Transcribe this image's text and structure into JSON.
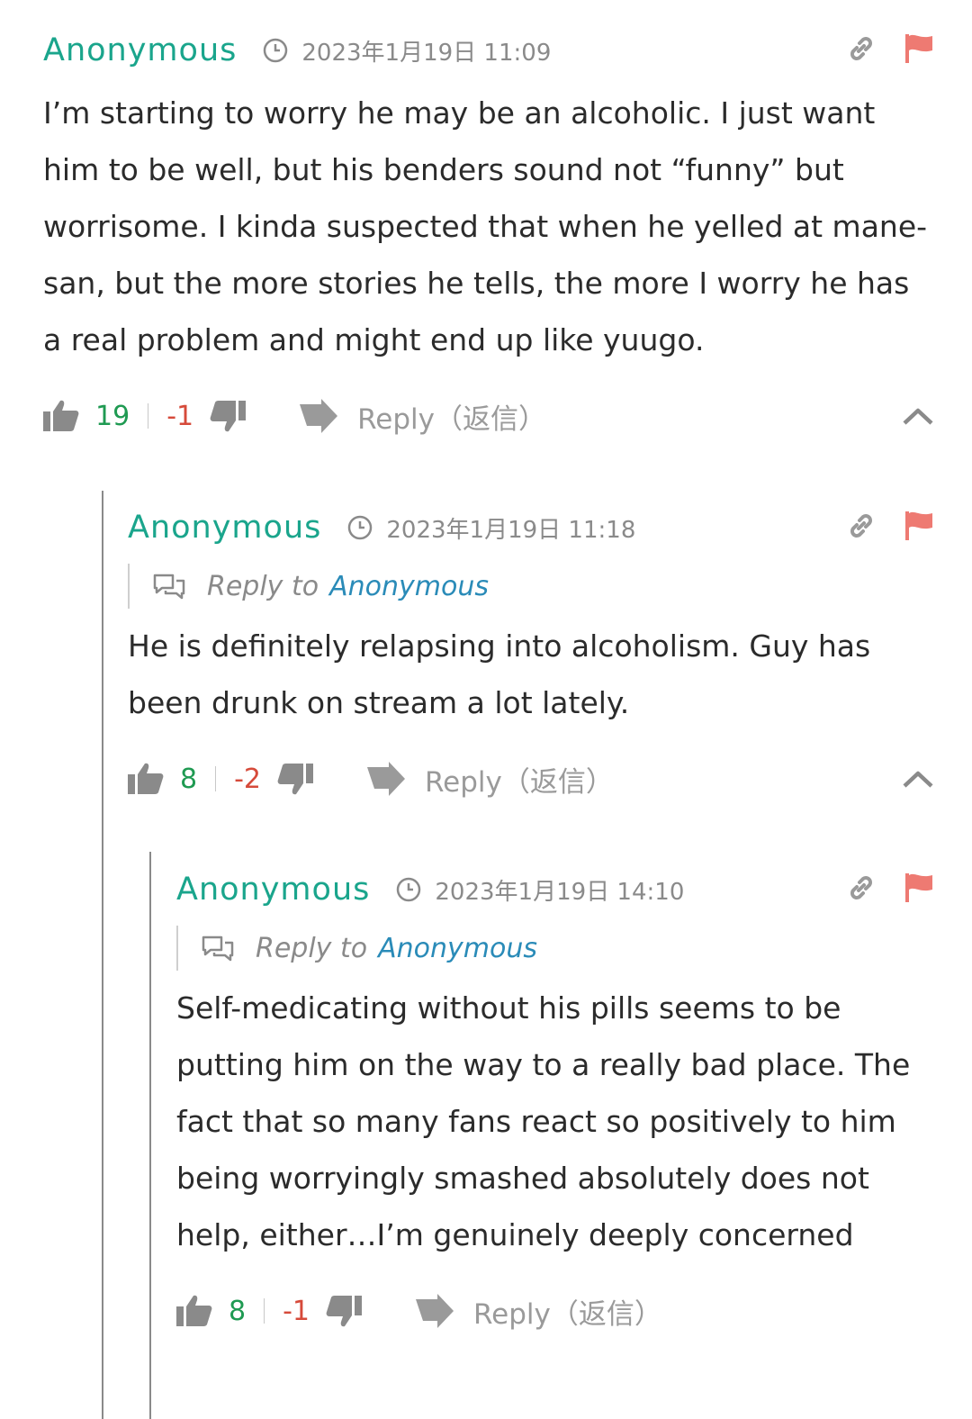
{
  "comments": [
    {
      "author": "Anonymous",
      "timestamp": "2023年1月19日 11:09",
      "body": "I’m starting to worry he may be an alcoholic. I just want him to be well, but his benders sound not “funny” but worrisome. I kinda suspected that when he yelled at mane-san, but the more stories he tells, the more I worry he has a real problem and might end up like yuugo.",
      "upvotes": "19",
      "downvotes": "-1",
      "reply_label": "Reply（返信）"
    },
    {
      "author": "Anonymous",
      "timestamp": "2023年1月19日 11:18",
      "reply_to_label": "Reply to",
      "reply_to_name": "Anonymous",
      "body": "He is definitely relapsing into alcoholism. Guy has been drunk on stream a lot lately.",
      "upvotes": "8",
      "downvotes": "-2",
      "reply_label": "Reply（返信）"
    },
    {
      "author": "Anonymous",
      "timestamp": "2023年1月19日 14:10",
      "reply_to_label": "Reply to",
      "reply_to_name": "Anonymous",
      "body": "Self-medicating without his pills seems to be putting him on the way to a really bad place. The fact that so many fans react so positively to him being worryingly smashed absolutely does not help, either…I’m genuinely deeply concerned",
      "upvotes": "8",
      "downvotes": "-1",
      "reply_label": "Reply（返信）"
    }
  ],
  "colors": {
    "author": "#1aa58c",
    "upvote": "#1f9a52",
    "downvote": "#d64a3a",
    "flag": "#ee7a72",
    "reply_to_name": "#2a8bb8",
    "muted": "#8a8a8a"
  },
  "icons": [
    "clock-icon",
    "link-icon",
    "flag-icon",
    "thumbs-up-icon",
    "thumbs-down-icon",
    "reply-arrow-icon",
    "chevron-up-icon",
    "chat-bubbles-icon"
  ]
}
